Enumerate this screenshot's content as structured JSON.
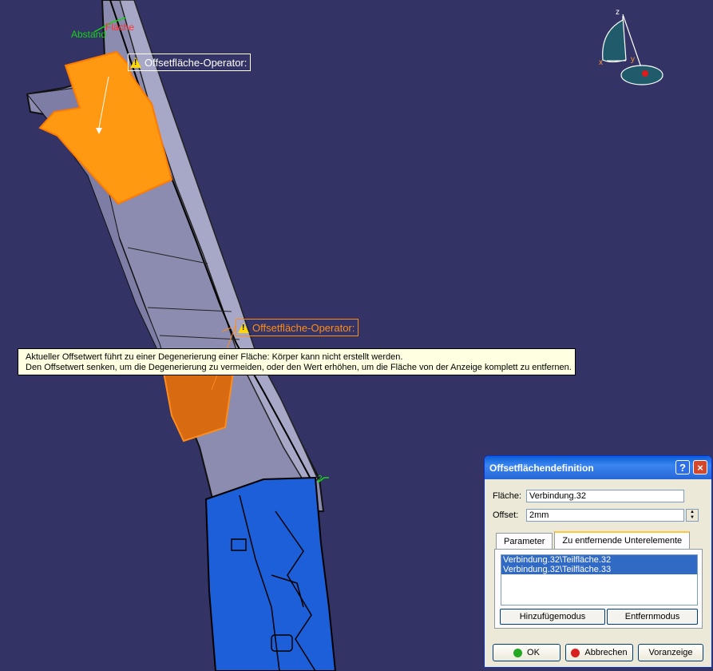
{
  "viewport": {
    "background": "#333366",
    "labels": {
      "abstand": "Abstand",
      "flache": "Fläche",
      "constraint_2": "2"
    },
    "compass": {
      "x": "x",
      "y": "y",
      "z": "z"
    },
    "operators": [
      {
        "label": "Offsetfläche-Operator:",
        "color": "#ffffff"
      },
      {
        "label": "Offsetfläche-Operator:",
        "color": "#ff8c1a"
      }
    ],
    "tooltip": {
      "line1": "Aktueller Offsetwert führt zu einer Degenerierung einer Fläche: Körper kann nicht erstellt werden.",
      "line2": "Den Offsetwert senken, um die Degenerierung zu vermeiden, oder den Wert erhöhen, um die Fläche von der Anzeige komplett zu entfernen."
    }
  },
  "dialog": {
    "title": "Offsetflächendefinition",
    "help": "?",
    "close": "×",
    "surface_label": "Fläche:",
    "surface_value": "Verbindung.32",
    "offset_label": "Offset:",
    "offset_value": "2mm",
    "tabs": [
      "Parameter",
      "Zu entfernende Unterelemente"
    ],
    "active_tab": 1,
    "list_items": [
      "Verbindung.32\\Teilfläche.32",
      "Verbindung.32\\Teilfläche.33"
    ],
    "add_mode": "Hinzufügemodus",
    "remove_mode": "Entfernmodus",
    "ok": "OK",
    "cancel": "Abbrechen",
    "preview": "Voranzeige"
  },
  "colors": {
    "orange": "#ff9912",
    "blue_part": "#1c5fd8",
    "grey_part": "#8c8cb0"
  }
}
